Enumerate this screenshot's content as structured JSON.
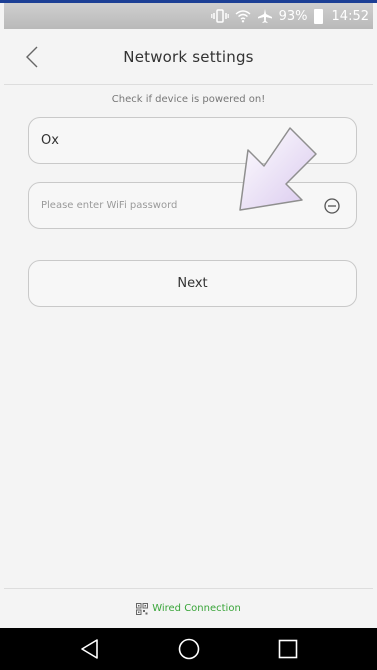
{
  "status_bar": {
    "battery_percent": "93%",
    "time": "14:52",
    "icons": [
      "vibrate-icon",
      "wifi-icon",
      "airplane-icon",
      "battery-icon"
    ]
  },
  "header": {
    "title": "Network settings",
    "back_icon": "chevron-left-icon"
  },
  "form": {
    "hint": "Check if device is powered on!",
    "ssid_value": "Ox",
    "password_placeholder": "Please enter WiFi password",
    "password_value": "",
    "toggle_icon": "eye-toggle-icon",
    "next_label": "Next"
  },
  "overlay": {
    "arrow_icon": "pointer-arrow-icon"
  },
  "footer": {
    "wired_label": "Wired Connection",
    "wired_icon": "qr-code-icon",
    "wired_color": "#3aa53a"
  },
  "system_nav": {
    "icons": [
      "back-triangle-icon",
      "home-circle-icon",
      "recents-square-icon"
    ]
  }
}
